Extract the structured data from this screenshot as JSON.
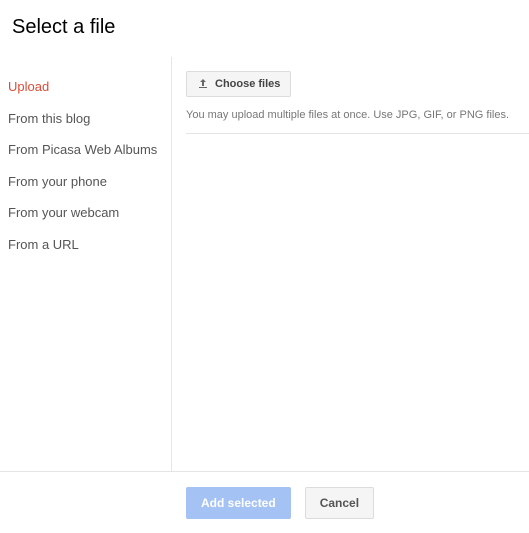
{
  "header": {
    "title": "Select a file"
  },
  "sidebar": {
    "items": [
      {
        "label": "Upload",
        "active": true
      },
      {
        "label": "From this blog",
        "active": false
      },
      {
        "label": "From Picasa Web Albums",
        "active": false
      },
      {
        "label": "From your phone",
        "active": false
      },
      {
        "label": "From your webcam",
        "active": false
      },
      {
        "label": "From a URL",
        "active": false
      }
    ]
  },
  "main": {
    "choose_label": "Choose files",
    "hint": "You may upload multiple files at once. Use JPG, GIF, or PNG files."
  },
  "footer": {
    "primary_label": "Add selected",
    "cancel_label": "Cancel"
  }
}
